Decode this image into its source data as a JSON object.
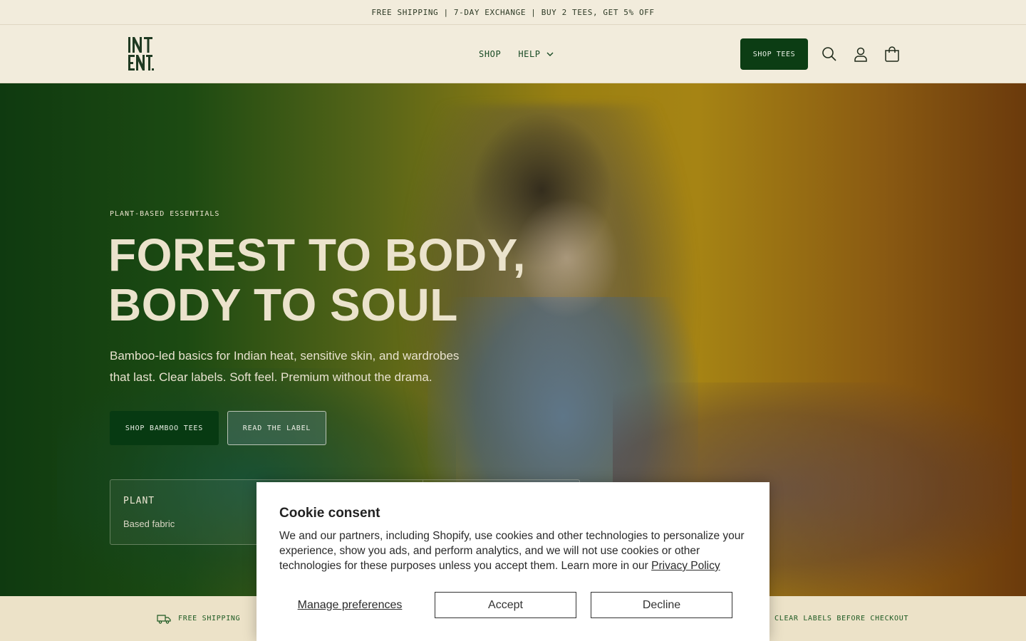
{
  "announcement": "FREE SHIPPING | 7-DAY EXCHANGE | BUY 2 TEES, GET 5% OFF",
  "header": {
    "logo": "INTENT",
    "nav": {
      "shop": "SHOP",
      "help": "HELP"
    },
    "cta": "SHOP TEES",
    "icons": [
      "search-icon",
      "account-icon",
      "cart-icon"
    ]
  },
  "hero": {
    "eyebrow": "PLANT-BASED ESSENTIALS",
    "headline_line1": "FOREST TO BODY,",
    "headline_line2": "BODY TO SOUL",
    "subcopy": "Bamboo-led basics for Indian heat, sensitive skin, and wardrobes that last. Clear labels. Soft feel. Premium without the drama.",
    "primary_cta": "SHOP BAMBOO TEES",
    "secondary_cta": "READ THE LABEL",
    "stat": {
      "title": "PLANT",
      "subtitle": "Based fabric"
    }
  },
  "features": {
    "shipping": "FREE SHIPPING",
    "labels": "CLEAR LABELS BEFORE CHECKOUT"
  },
  "cookie": {
    "title": "Cookie consent",
    "body": "We and our partners, including Shopify, use cookies and other technologies to personalize your experience, show you ads, and perform analytics, and we will not use cookies or other technologies for these purposes unless you accept them. Learn more in our",
    "privacy_link": "Privacy Policy",
    "manage": "Manage preferences",
    "accept": "Accept",
    "decline": "Decline"
  },
  "colors": {
    "brand_green": "#0c3d14",
    "cream": "#f2ecdc",
    "feature_bar": "#ece2c8"
  }
}
